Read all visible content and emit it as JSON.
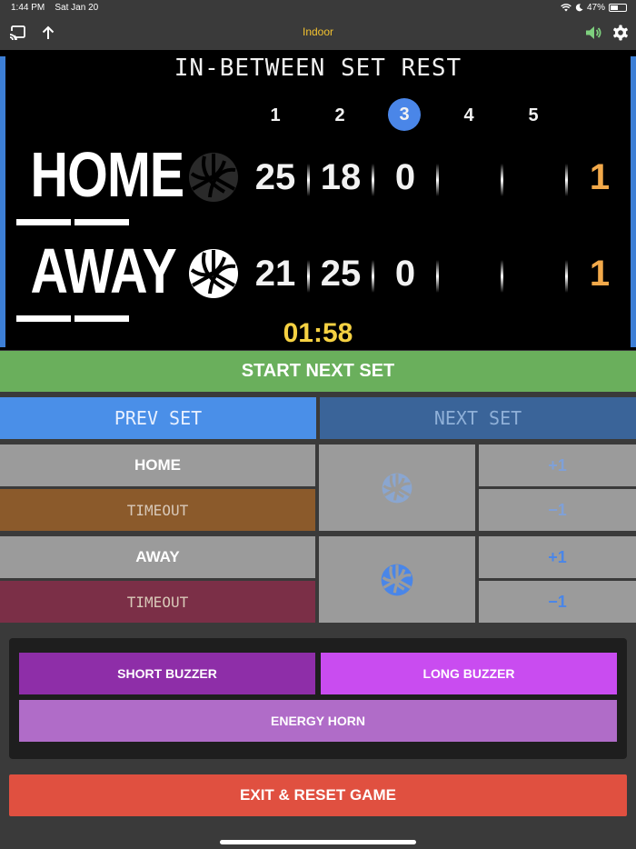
{
  "status_bar": {
    "time": "1:44 PM",
    "date": "Sat Jan 20",
    "battery": "47%",
    "battery_level": 0.47
  },
  "header": {
    "title": "Indoor"
  },
  "icons": {
    "cast": "cast-icon",
    "upload": "upload-arrow-icon",
    "sound": "speaker-icon",
    "settings": "gear-icon"
  },
  "board": {
    "title": "IN-BETWEEN SET REST",
    "set_numbers": [
      "1",
      "2",
      "3",
      "4",
      "5"
    ],
    "active_set": "3",
    "home": {
      "name": "HOME",
      "scores": [
        "25",
        "18",
        "0",
        "",
        ""
      ],
      "sets_won": "1",
      "serving": false
    },
    "away": {
      "name": "AWAY",
      "scores": [
        "21",
        "25",
        "0",
        "",
        ""
      ],
      "sets_won": "1",
      "serving": true
    },
    "clock": "01:58"
  },
  "controls": {
    "start_next_set": "START NEXT SET",
    "prev_set": "PREV SET",
    "next_set": "NEXT SET",
    "home_label": "HOME",
    "away_label": "AWAY",
    "timeout_label": "TIMEOUT",
    "plus_one": "+1",
    "minus_one": "−1"
  },
  "buzzers": {
    "short": "SHORT BUZZER",
    "long": "LONG BUZZER",
    "energy": "ENERGY HORN"
  },
  "exit_label": "EXIT & RESET GAME",
  "colors": {
    "accent_blue": "#4a86e8",
    "start_green": "#6aaf5c",
    "home_timeout": "#8b5a2b",
    "away_timeout": "#7b2f47",
    "short_buzzer": "#8e2ea8",
    "long_buzzer": "#c94cf0",
    "energy_horn": "#b06cc8",
    "exit_red": "#e05040",
    "clock_yellow": "#f5d142",
    "sets_orange": "#f2a94a"
  }
}
